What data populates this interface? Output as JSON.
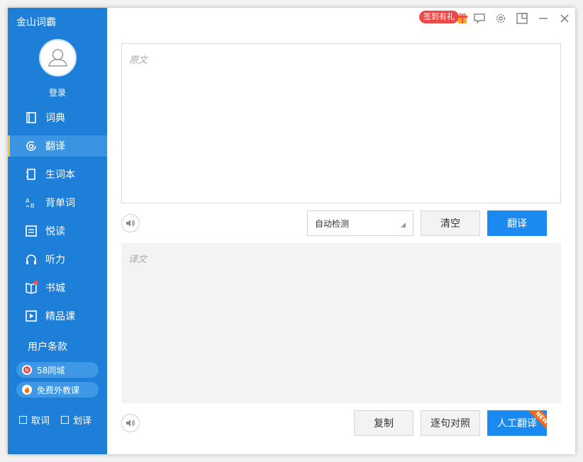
{
  "app": {
    "title": "金山词霸"
  },
  "user": {
    "login_label": "登录"
  },
  "sidebar": {
    "items": [
      {
        "label": "词典",
        "icon": "book-icon",
        "active": false
      },
      {
        "label": "翻译",
        "icon": "translate-icon",
        "active": true
      },
      {
        "label": "生词本",
        "icon": "notebook-icon",
        "active": false
      },
      {
        "label": "背单词",
        "icon": "abc-icon",
        "active": false
      },
      {
        "label": "悦读",
        "icon": "reading-icon",
        "active": false
      },
      {
        "label": "听力",
        "icon": "headphones-icon",
        "active": false
      },
      {
        "label": "书城",
        "icon": "bookstore-icon",
        "active": false
      },
      {
        "label": "精品课",
        "icon": "play-icon",
        "active": false
      }
    ],
    "terms_label": "用户条款",
    "promos": [
      {
        "label": "58同城",
        "icon": "58-icon",
        "color": "#e84545"
      },
      {
        "label": "免费外教课",
        "icon": "flame-icon",
        "color": "#ff6a00"
      }
    ],
    "checks": [
      {
        "label": "取词",
        "checked": false
      },
      {
        "label": "划译",
        "checked": false
      }
    ]
  },
  "titlebar": {
    "signin_badge": "签到有礼",
    "icons": [
      "gift-icon",
      "feedback-icon",
      "settings-icon",
      "minimize-to-tray-icon",
      "minimize-icon",
      "close-icon"
    ]
  },
  "translate": {
    "source_placeholder": "原文",
    "lang_select": "自动检测",
    "clear_label": "清空",
    "translate_label": "翻译",
    "output_placeholder": "译文",
    "copy_label": "复制",
    "compare_label": "逐句对照",
    "human_label": "人工翻译",
    "new_badge": "NEW"
  },
  "colors": {
    "sidebar": "#1d7fd8",
    "accent": "#1b8af0",
    "active_marker": "#f5c33b"
  }
}
